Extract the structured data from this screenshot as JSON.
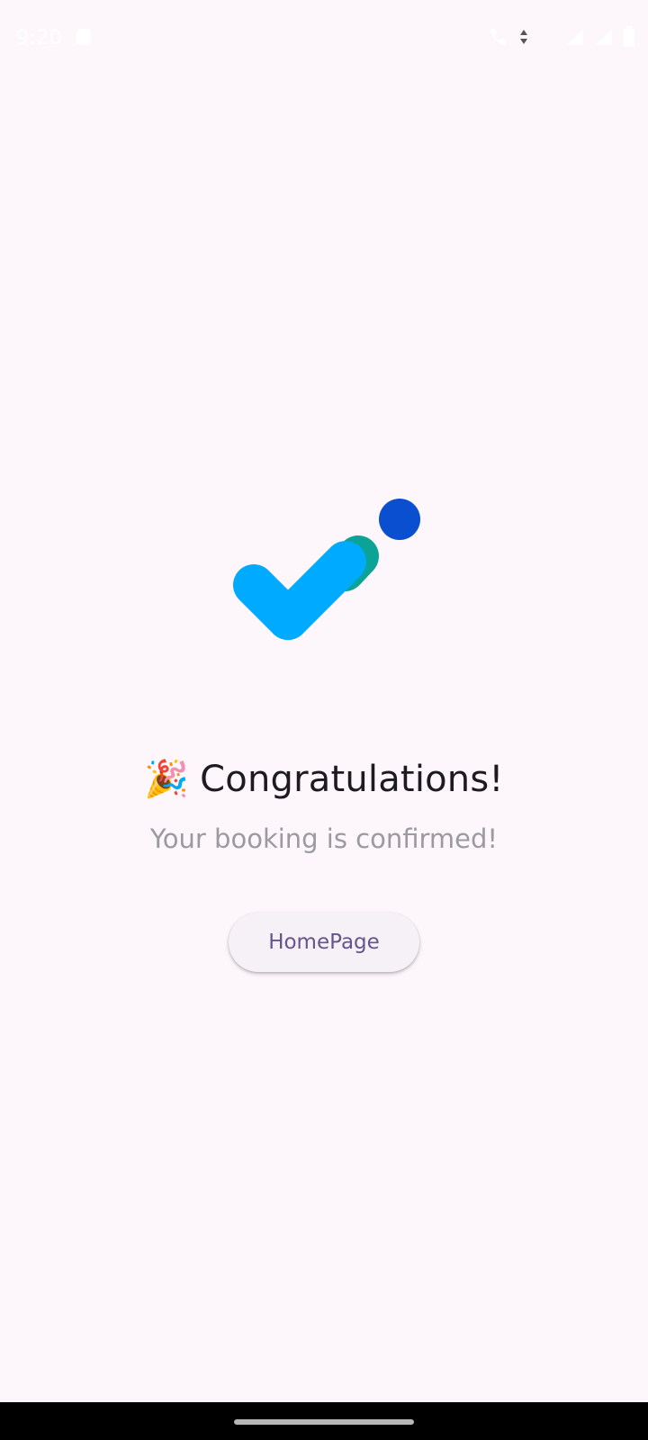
{
  "status_bar": {
    "time": "9:20",
    "left_icons": [
      "notification-icon"
    ],
    "right_icons": [
      "call-icon",
      "data-arrows-icon",
      "signal-icon",
      "signal-icon",
      "battery-icon"
    ]
  },
  "illustration": {
    "icon": "checkmark-success-icon",
    "colors": {
      "check": "#00aaff",
      "tail": "#0aa395",
      "dot": "#0a4fd0"
    }
  },
  "main": {
    "emoji": "🎉",
    "title": "Congratulations!",
    "subtitle": "Your booking is confirmed!",
    "button_label": "HomePage"
  },
  "colors": {
    "background": "#fdf7fc",
    "title": "#1d1b20",
    "subtitle": "#9a9a9f",
    "button_text": "#65558f",
    "button_bg": "#f6f1f7"
  }
}
